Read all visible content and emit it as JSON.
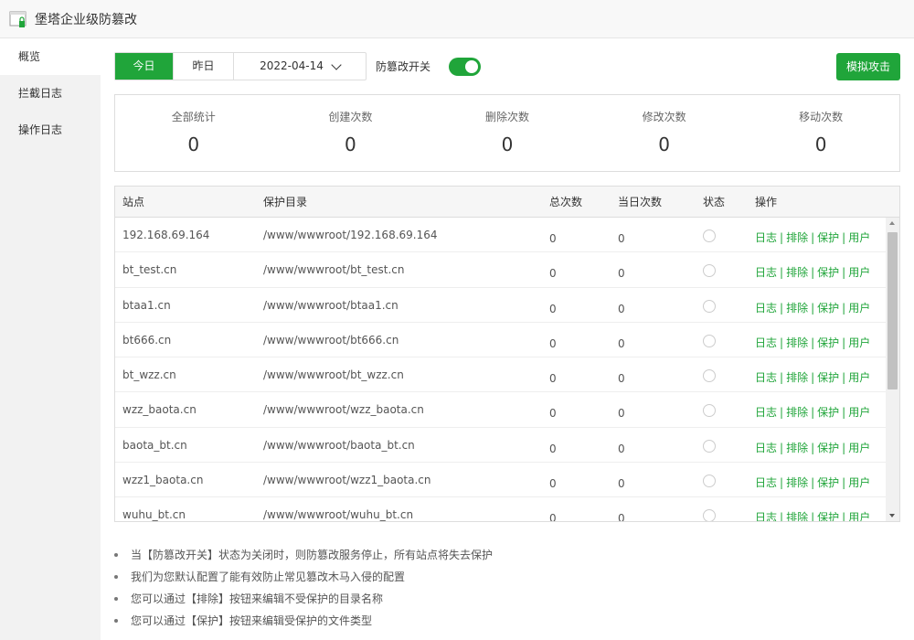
{
  "app": {
    "title": "堡塔企业级防篡改"
  },
  "sidebar": {
    "items": [
      {
        "label": "概览",
        "active": true
      },
      {
        "label": "拦截日志",
        "active": false
      },
      {
        "label": "操作日志",
        "active": false
      }
    ]
  },
  "toolbar": {
    "today_label": "今日",
    "yesterday_label": "昨日",
    "date_value": "2022-04-14",
    "toggle_label": "防篡改开关",
    "toggle_on": true,
    "attack_button": "模拟攻击"
  },
  "stats": [
    {
      "label": "全部统计",
      "value": "0"
    },
    {
      "label": "创建次数",
      "value": "0"
    },
    {
      "label": "删除次数",
      "value": "0"
    },
    {
      "label": "修改次数",
      "value": "0"
    },
    {
      "label": "移动次数",
      "value": "0"
    }
  ],
  "table": {
    "headers": {
      "site": "站点",
      "dir": "保护目录",
      "total": "总次数",
      "today": "当日次数",
      "status": "状态",
      "ops": "操作"
    },
    "ops_labels": {
      "log": "日志",
      "exclude": "排除",
      "protect": "保护",
      "user": "用户"
    },
    "rows": [
      {
        "site": "192.168.69.164",
        "dir": "/www/wwwroot/192.168.69.164",
        "total": "0",
        "today": "0"
      },
      {
        "site": "bt_test.cn",
        "dir": "/www/wwwroot/bt_test.cn",
        "total": "0",
        "today": "0"
      },
      {
        "site": "btaa1.cn",
        "dir": "/www/wwwroot/btaa1.cn",
        "total": "0",
        "today": "0"
      },
      {
        "site": "bt666.cn",
        "dir": "/www/wwwroot/bt666.cn",
        "total": "0",
        "today": "0"
      },
      {
        "site": "bt_wzz.cn",
        "dir": "/www/wwwroot/bt_wzz.cn",
        "total": "0",
        "today": "0"
      },
      {
        "site": "wzz_baota.cn",
        "dir": "/www/wwwroot/wzz_baota.cn",
        "total": "0",
        "today": "0"
      },
      {
        "site": "baota_bt.cn",
        "dir": "/www/wwwroot/baota_bt.cn",
        "total": "0",
        "today": "0"
      },
      {
        "site": "wzz1_baota.cn",
        "dir": "/www/wwwroot/wzz1_baota.cn",
        "total": "0",
        "today": "0"
      },
      {
        "site": "wuhu_bt.cn",
        "dir": "/www/wwwroot/wuhu_bt.cn",
        "total": "0",
        "today": "0"
      }
    ]
  },
  "notes": [
    "当【防篡改开关】状态为关闭时，则防篡改服务停止，所有站点将失去保护",
    "我们为您默认配置了能有效防止常见篡改木马入侵的配置",
    "您可以通过【排除】按钮来编辑不受保护的目录名称",
    "您可以通过【保护】按钮来编辑受保护的文件类型"
  ],
  "colors": {
    "accent": "#20a53a"
  }
}
